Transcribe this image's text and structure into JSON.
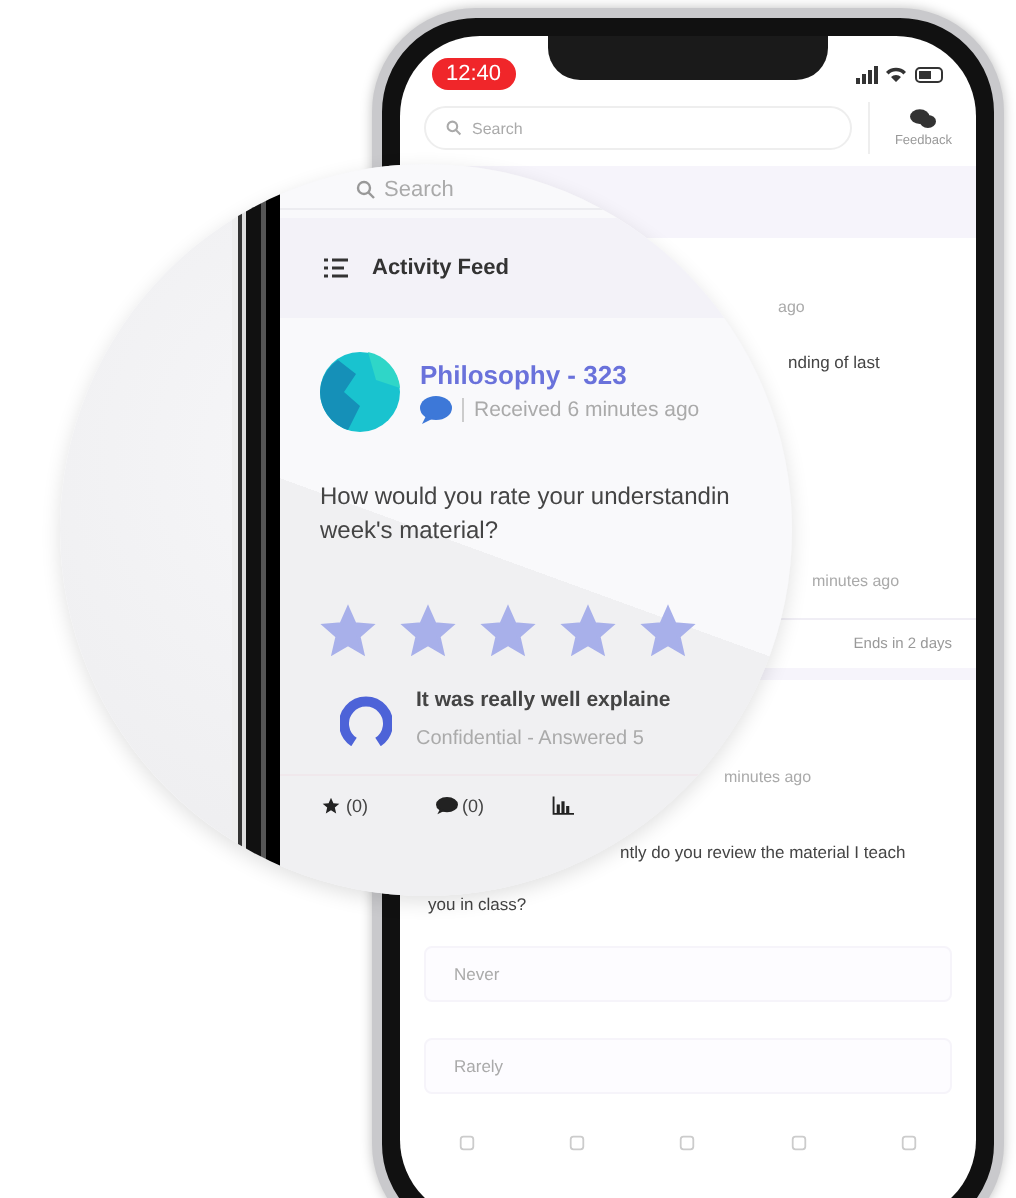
{
  "status_bar": {
    "time": "12:40"
  },
  "header": {
    "search": {
      "placeholder": "Search"
    },
    "feedback": "Feedback"
  },
  "feed": {
    "card_1": {
      "time": "ago",
      "question": "nding of last",
      "answer_time": "minutes ago",
      "deadline": "Ends in 2 days"
    },
    "card_2": {
      "time": "minutes ago",
      "question_lines": [
        "ntly do you review the material I teach",
        "you in class?"
      ],
      "options": [
        "Never",
        "Rarely"
      ]
    }
  },
  "magnifier": {
    "search": {
      "placeholder": "Search"
    },
    "title": "Activity Feed",
    "card": {
      "course": "Philosophy - 323",
      "received": "Received 6 minutes ago",
      "question_lines": [
        "How would you rate your understandin",
        "week's material?"
      ],
      "stars": 5,
      "answer": {
        "text": "It was really well explaine",
        "meta": "Confidential - Answered 5"
      },
      "actions": [
        {
          "kind": "star",
          "count": "(0)"
        },
        {
          "kind": "comment",
          "count": "(0)"
        },
        {
          "kind": "chart"
        }
      ]
    }
  }
}
